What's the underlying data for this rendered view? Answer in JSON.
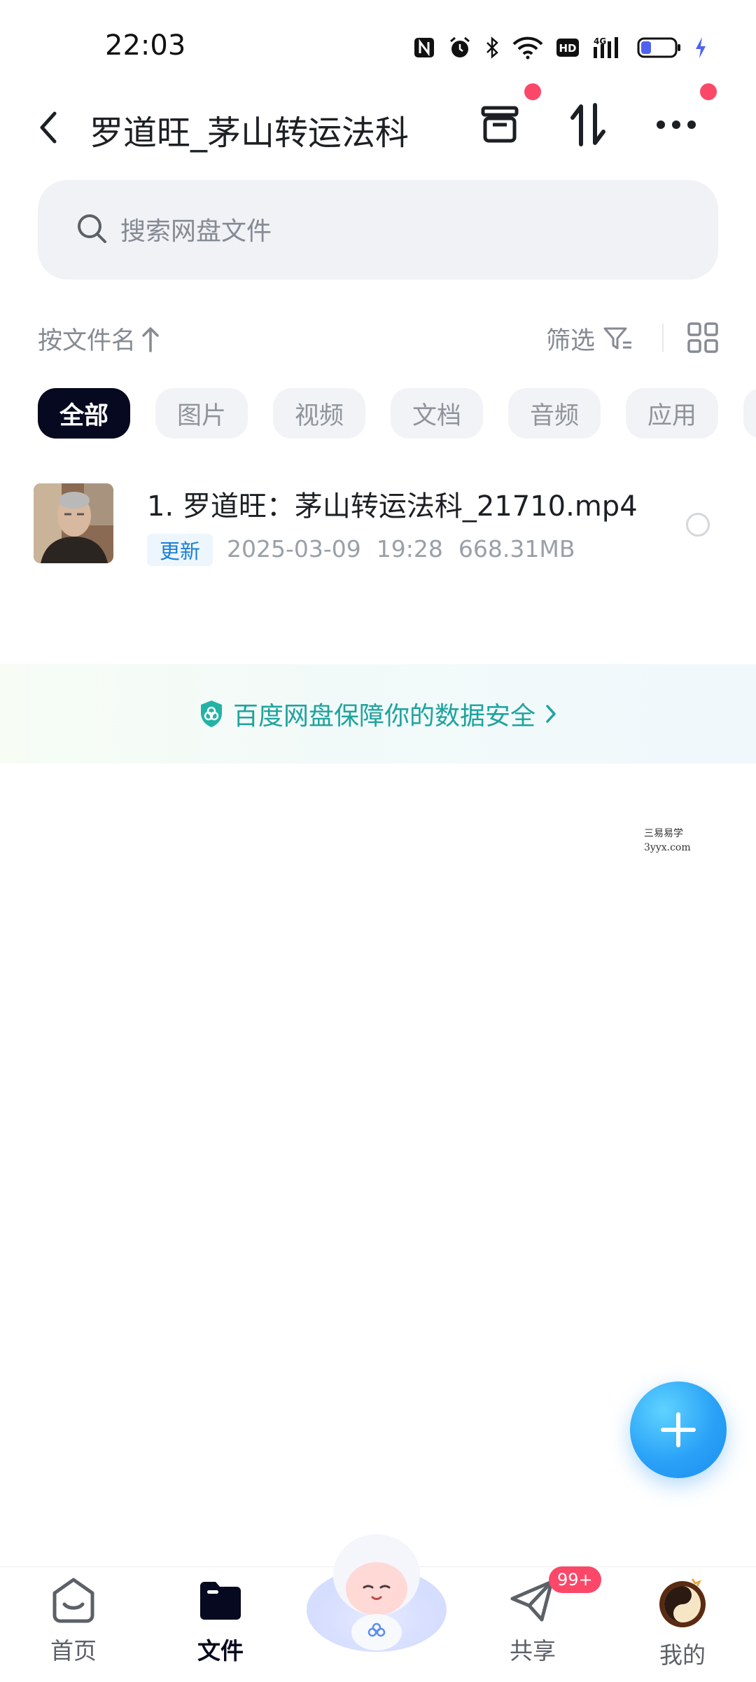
{
  "status_bar": {
    "time": "22:03",
    "icons": [
      "nfc-icon",
      "alarm-icon",
      "bluetooth-icon",
      "wifi-icon",
      "hd-icon",
      "4g-signal-icon",
      "battery-icon",
      "charging-icon"
    ]
  },
  "header": {
    "title": "罗道旺_茅山转运法科",
    "actions": [
      "back-icon",
      "archive-icon",
      "sort-arrows-icon",
      "more-icon"
    ],
    "notification_dot_color": "#fb4869"
  },
  "search": {
    "placeholder": "搜索网盘文件",
    "value": ""
  },
  "sort_bar": {
    "sort_label": "按文件名",
    "sort_direction_icon": "arrow-up-icon",
    "filter_label": "筛选",
    "view_icon": "grid-icon"
  },
  "categories": {
    "items": [
      {
        "label": "全部",
        "active": true
      },
      {
        "label": "图片",
        "active": false
      },
      {
        "label": "视频",
        "active": false
      },
      {
        "label": "文档",
        "active": false
      },
      {
        "label": "音频",
        "active": false
      },
      {
        "label": "应用",
        "active": false
      }
    ]
  },
  "files": [
    {
      "name": "1. 罗道旺：茅山转运法科_21710.mp4",
      "badge": "更新",
      "date": "2025-03-09",
      "time": "19:28",
      "size": "668.31MB"
    }
  ],
  "security_banner": {
    "text": "百度网盘保障你的数据安全",
    "icon": "shield-icon",
    "accent_color": "#1ea39f"
  },
  "watermark": {
    "line1": "三易易学",
    "line2": "3yyx.com"
  },
  "fab": {
    "icon": "plus-icon",
    "color": "#2aa2f7"
  },
  "bottom_nav": {
    "items": [
      {
        "label": "首页",
        "icon": "home-face-icon",
        "active": false
      },
      {
        "label": "文件",
        "icon": "folder-icon",
        "active": true
      },
      {
        "label": "共享",
        "icon": "paper-plane-icon",
        "active": false,
        "badge": "99+"
      },
      {
        "label": "我的",
        "icon": "avatar-icon",
        "active": false
      }
    ],
    "center_icon": "mascot-icon"
  }
}
